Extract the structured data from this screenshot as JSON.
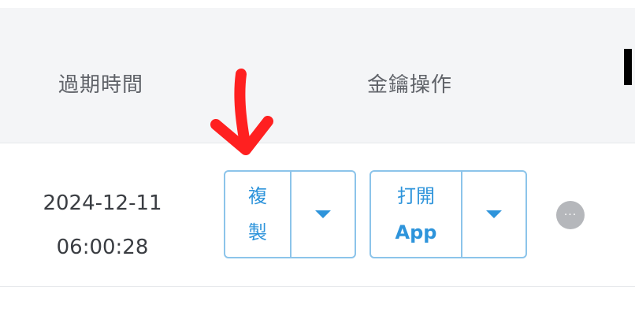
{
  "table": {
    "headers": {
      "expiry": "過期時間",
      "key_ops": "金鑰操作"
    },
    "row": {
      "expiry_date": "2024-12-11",
      "expiry_time": "06:00:28",
      "copy_button": {
        "line1": "複",
        "line2": "製"
      },
      "open_button": {
        "line1": "打開",
        "line2": "App"
      },
      "more_label": "···"
    }
  },
  "colors": {
    "accent": "#2e94db",
    "button_border": "#8cc4ea",
    "header_bg": "#f4f5f7",
    "annotation_arrow": "#ff2020"
  },
  "icons": {
    "dropdown": "caret-down-icon",
    "more": "more-horizontal-icon",
    "annotation": "red-arrow-down-icon"
  }
}
